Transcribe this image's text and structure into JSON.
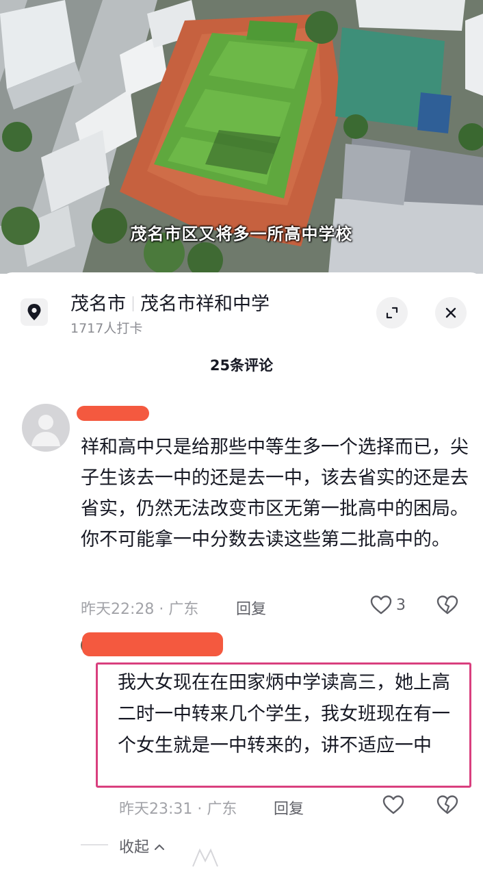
{
  "video": {
    "caption": "茂名市区又将多一所高中学校"
  },
  "location": {
    "city": "茂名市",
    "place": "茂名市祥和中学",
    "checkins": "1717人打卡",
    "pin_icon": "location-pin-icon",
    "expand_icon": "expand-icon",
    "close_icon": "close-icon"
  },
  "comments": {
    "count_label": "25条评论",
    "first": {
      "text": "祥和高中只是给那些中等生多一个选择而已，尖子生该去一中的还是去一中，该去省实的还是去省实，仍然无法改变市区无第一批高中的困局。你不可能拿一中分数去读这些第二批高中的。",
      "time": "昨天22:28 · 广东",
      "reply_label": "回复",
      "like_count": "3"
    },
    "second": {
      "text": "我大女现在在田家炳中学读高三，她上高二时一中转来几个学生，我女班现在有一个女生就是一中转来的，讲不适应一中",
      "time": "昨天23:31 · 广东",
      "reply_label": "回复"
    },
    "collapse_label": "收起"
  },
  "colors": {
    "redaction": "#f4593f",
    "highlight_box": "#d93f7e"
  }
}
